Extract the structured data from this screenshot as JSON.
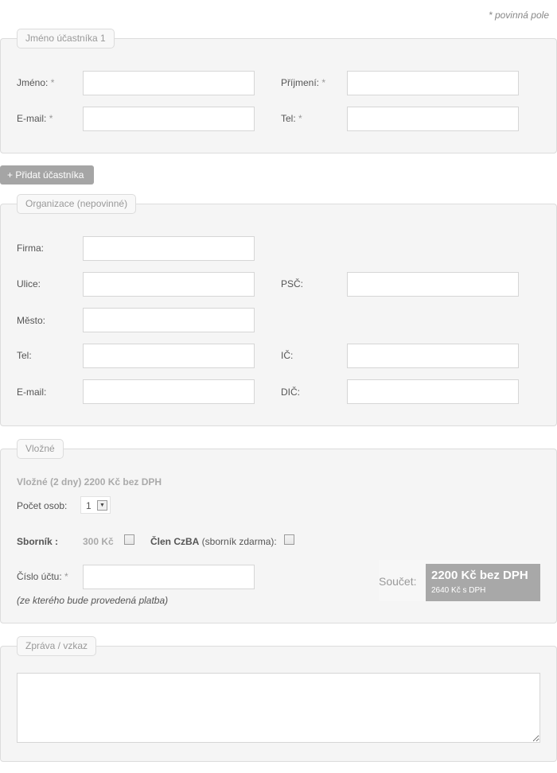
{
  "required_note": "* povinná pole",
  "participant": {
    "legend": "Jméno účastníka 1",
    "first_name": {
      "label": "Jméno:",
      "star": "*",
      "value": ""
    },
    "last_name": {
      "label": "Příjmení:",
      "star": "*",
      "value": ""
    },
    "email": {
      "label": "E-mail:",
      "star": "*",
      "value": ""
    },
    "phone": {
      "label": "Tel:",
      "star": "*",
      "value": ""
    }
  },
  "add_participant_button": "+ Přidat účastníka",
  "organization": {
    "legend": "Organizace (nepovinné)",
    "company": {
      "label": "Firma:",
      "value": ""
    },
    "street": {
      "label": "Ulice:",
      "value": ""
    },
    "zip": {
      "label": "PSČ:",
      "value": ""
    },
    "city": {
      "label": "Město:",
      "value": ""
    },
    "phone": {
      "label": "Tel:",
      "value": ""
    },
    "ico": {
      "label": "IČ:",
      "value": ""
    },
    "email": {
      "label": "E-mail:",
      "value": ""
    },
    "dic": {
      "label": "DIČ:",
      "value": ""
    }
  },
  "fee": {
    "legend": "Vložné",
    "heading": "Vložné (2 dny) 2200 Kč bez DPH",
    "persons_label": "Počet osob:",
    "persons_value": "1",
    "proceedings_label": "Sborník :",
    "proceedings_price": "300 Kč",
    "proceedings_checked": false,
    "member_label_bold": "Člen CzBA",
    "member_label_rest": " (sborník zdarma):",
    "member_checked": false,
    "account_label": "Číslo účtu:",
    "account_star": "*",
    "account_value": "",
    "account_note": "(ze kterého bude provedená platba)",
    "total_label": "Součet:",
    "total_main": "2200 Kč bez DPH",
    "total_sub": "2640 Kč s DPH"
  },
  "message": {
    "legend": "Zpráva / vzkaz",
    "value": ""
  },
  "colors": {
    "panel_bg": "#f5f5f5",
    "border": "#dcdcdc",
    "button_bg": "#a5a5a5",
    "total_bg": "#a8a8a8"
  }
}
